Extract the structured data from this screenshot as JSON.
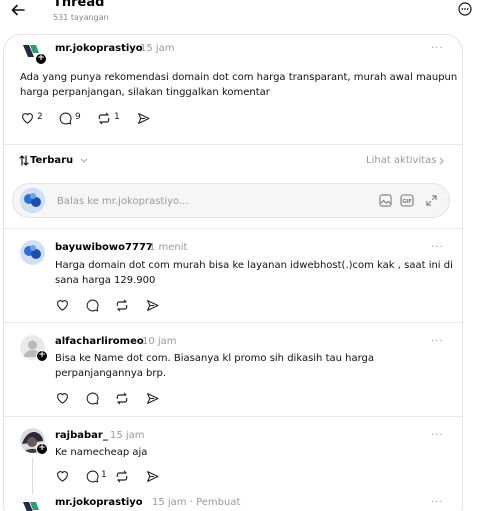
{
  "header": {
    "title": "Thread",
    "views": "531 tayangan"
  },
  "main_post": {
    "username": "mr.jokoprastiyo",
    "time": "15 jam",
    "more": "···",
    "text_line1": "Ada yang punya rekomendasi domain dot com harga transparant, murah awal maupun",
    "text_line2": "harga perpanjangan, silakan tinggalkan komentar",
    "likes": "2",
    "comments": "9",
    "reposts": "1"
  },
  "sort": {
    "label": "Terbaru",
    "activity_link": "Lihat aktivitas"
  },
  "reply_box": {
    "placeholder": "Balas ke mr.jokoprastiyo..."
  },
  "replies": [
    {
      "username": "bayuwibowo7777",
      "time": "1 menit",
      "more": "···",
      "text_line1": "Harga domain dot com murah bisa ke layanan idwebhost(.)com kak , saat ini di",
      "text_line2": "sana harga 129.900",
      "comments": ""
    },
    {
      "username": "alfacharliromeo",
      "time": "10 jam",
      "more": "···",
      "text_line1": "Bisa ke Name dot com. Biasanya kl promo sih dikasih tau harga",
      "text_line2": "perpanjangannya brp.",
      "comments": ""
    },
    {
      "username": "rajbabar_",
      "time": "15 jam",
      "more": "···",
      "text_line1": "Ke namecheap aja",
      "text_line2": "",
      "comments": "1"
    },
    {
      "username": "mr.jokoprastiyo",
      "time": "15 jam · Pembuat",
      "more": "···"
    }
  ],
  "colors": {
    "text": "#000000",
    "muted": "#9a9a9a",
    "border": "#e3e3e3",
    "avatar_green": "#2e7d5b",
    "avatar_blue": "#2a6fdb"
  }
}
